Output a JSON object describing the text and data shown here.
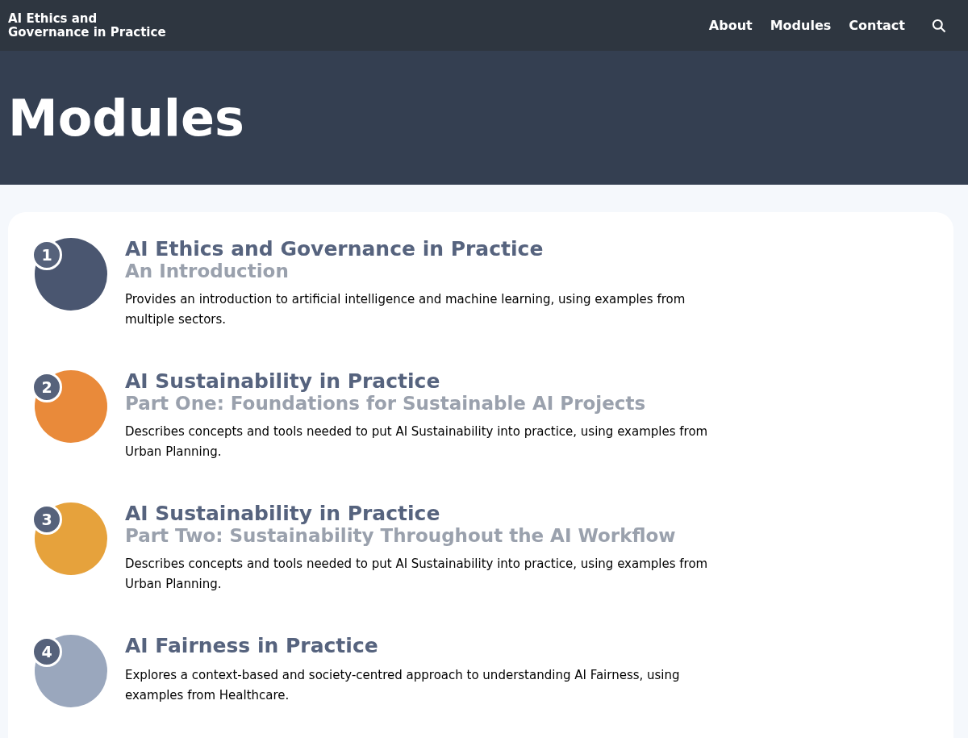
{
  "header": {
    "site_title_lines": [
      "AI Ethics and",
      "Governance in Practice"
    ],
    "nav": [
      "About",
      "Modules",
      "Contact"
    ]
  },
  "page_title": "Modules",
  "modules": [
    {
      "number": "1",
      "title": "AI Ethics and Governance in Practice",
      "subtitle": "An Introduction",
      "description": "Provides an introduction to artificial intelligence and machine learning, using examples from multiple sectors.",
      "color": "#4a5670"
    },
    {
      "number": "2",
      "title": "AI Sustainability in Practice",
      "subtitle": "Part One: Foundations for Sustainable AI Projects",
      "description": "Describes concepts and tools needed to put AI Sustainability into practice, using examples from Urban Planning.",
      "color": "#e98a3a"
    },
    {
      "number": "3",
      "title": "AI Sustainability in Practice",
      "subtitle": "Part Two: Sustainability Throughout the AI Workflow",
      "description": "Describes concepts and tools needed to put AI Sustainability into practice, using examples from Urban Planning.",
      "color": "#e6a23c"
    },
    {
      "number": "4",
      "title": "AI Fairness in Practice",
      "description": "Explores a context-based and society-centred approach to understanding AI Fairness, using examples from Healthcare.",
      "color": "#9aa7bd"
    }
  ]
}
